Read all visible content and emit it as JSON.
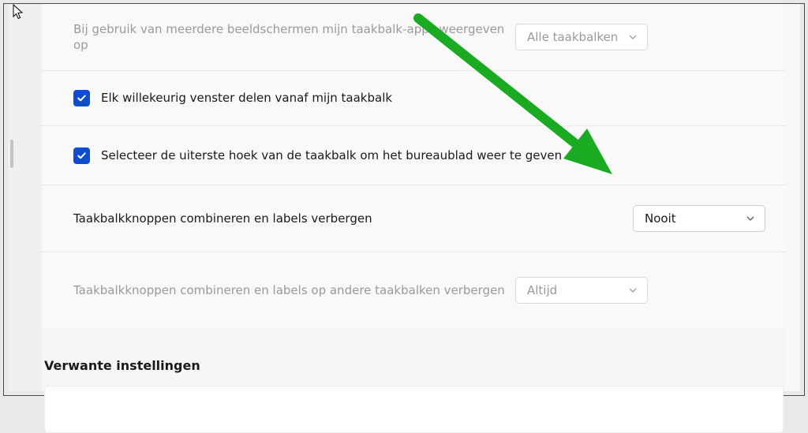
{
  "rows": {
    "multi_display": {
      "label": "Bij gebruik van meerdere beeldschermen mijn taakbalk-apps weergeven op",
      "value": "Alle taakbalken"
    },
    "share_window": {
      "label": "Elk willekeurig venster delen vanaf mijn taakbalk"
    },
    "show_desktop": {
      "label": "Selecteer de uiterste hoek van de taakbalk om het bureaublad weer te geven"
    },
    "combine_primary": {
      "label": "Taakbalkknoppen combineren en labels verbergen",
      "value": "Nooit"
    },
    "combine_other": {
      "label": "Taakbalkknoppen combineren en labels op andere taakbalken verbergen",
      "value": "Altijd"
    }
  },
  "section_title": "Verwante instellingen",
  "annotation": {
    "arrow_color": "#1bab23"
  }
}
